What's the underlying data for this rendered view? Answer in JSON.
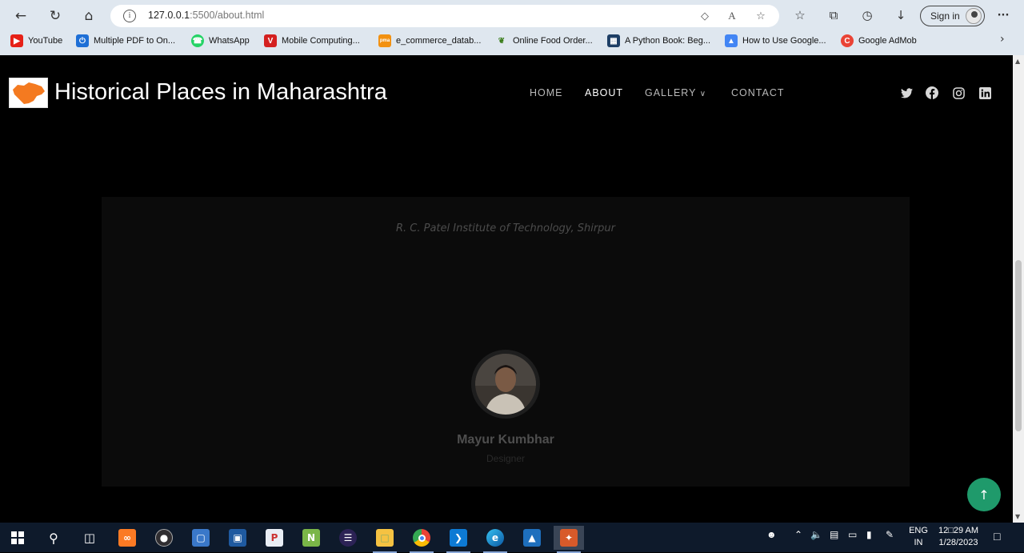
{
  "browser": {
    "url_host": "127.0.0.1",
    "url_port_path": ":5500/about.html",
    "signin_label": "Sign in",
    "more_label": "···"
  },
  "bookmarks": [
    {
      "label": "YouTube",
      "icon": "youtube-icon",
      "color": "#e62117"
    },
    {
      "label": "Multiple PDF to On...",
      "icon": "power-icon",
      "color": "#1e6fd6"
    },
    {
      "label": "WhatsApp",
      "icon": "whatsapp-icon",
      "color": "#25d366"
    },
    {
      "label": "Mobile Computing...",
      "icon": "v-logo-icon",
      "color": "#d42020"
    },
    {
      "label": "e_commerce_datab...",
      "icon": "pma-icon",
      "color": "#f29111"
    },
    {
      "label": "Online Food Order...",
      "icon": "leaf-icon",
      "color": "#3a7d1a"
    },
    {
      "label": "A Python Book: Beg...",
      "icon": "grid-icon",
      "color": "#1e3f66"
    },
    {
      "label": "How to Use Google...",
      "icon": "ads-icon",
      "color": "#4285f4"
    },
    {
      "label": "Google AdMob",
      "icon": "admob-icon",
      "color": "#ea4335"
    }
  ],
  "site": {
    "title": "Historical Places in Maharashtra",
    "menu": [
      {
        "label": "HOME",
        "active": false
      },
      {
        "label": "ABOUT",
        "active": true
      },
      {
        "label": "GALLERY",
        "active": false
      },
      {
        "label": "CONTACT",
        "active": false
      }
    ],
    "social": [
      "twitter-icon",
      "facebook-icon",
      "instagram-icon",
      "linkedin-icon"
    ]
  },
  "card": {
    "institute": "R. C. Patel Institute of Technology, Shirpur",
    "person_name": "Mayur Kumbhar",
    "person_role": "Designer"
  },
  "taskbar": {
    "lang_top": "ENG",
    "lang_bottom": "IN",
    "time": "12□29 AM",
    "date": "1/28/2023"
  },
  "colors": {
    "accent": "#1f9a6b",
    "page_bg": "#000000",
    "card_bg": "#0b0b0b"
  }
}
